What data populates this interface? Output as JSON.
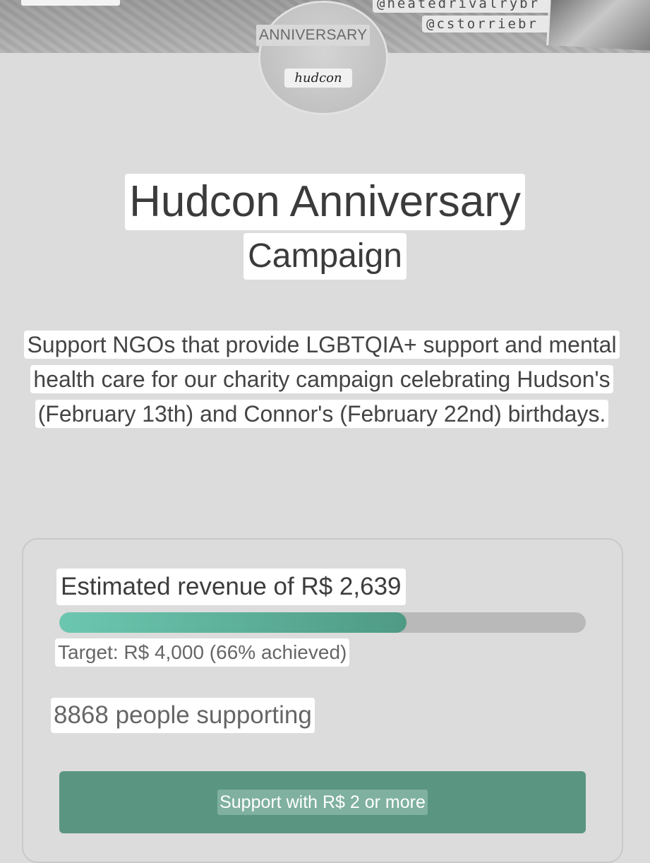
{
  "banner": {
    "handles": [
      "@heatedrivalrybr",
      "@cstorriebr"
    ]
  },
  "avatar": {
    "label": "ANNIVERSARY",
    "signature": "hudcon"
  },
  "campaign": {
    "title_line1": "Hudcon Anniversary",
    "title_line2": "Campaign",
    "description": "Support NGOs that provide LGBTQIA+ support and mental health care for our charity campaign celebrating Hudson's (February 13th) and Connor's (February 22nd) birthdays."
  },
  "stats": {
    "revenue_text": "Estimated revenue of R$ 2,639",
    "progress_percent": 66,
    "target_text": "Target: R$ 4,000 (66% achieved)",
    "supporters_text": "8868 people supporting"
  },
  "cta": {
    "label": "Support with R$ 2 or more"
  },
  "colors": {
    "accent": "#5a9582",
    "progress_start": "#6cc7b0",
    "progress_end": "#4f9a84"
  }
}
